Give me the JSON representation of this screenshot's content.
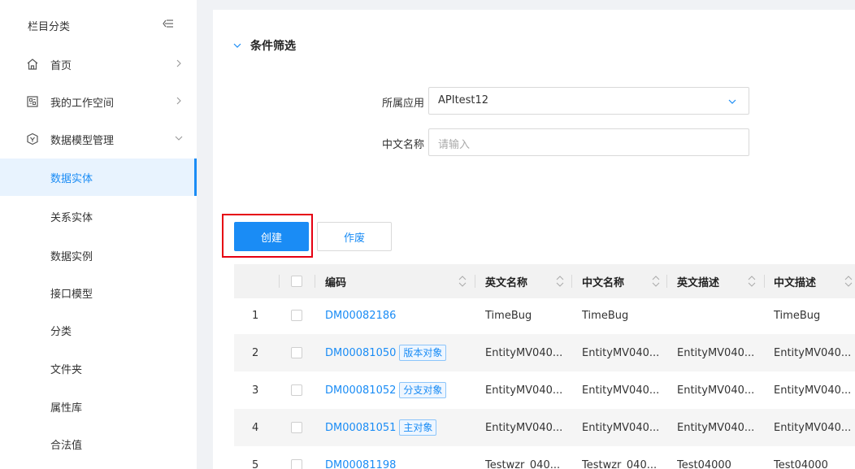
{
  "sidebar": {
    "title": "栏目分类",
    "collapse_icon": "collapse-left-icon",
    "menu": [
      {
        "label": "首页",
        "icon": "home-icon",
        "arrow": "chevron-right-icon"
      },
      {
        "label": "我的工作空间",
        "icon": "workspace-icon",
        "arrow": "chevron-right-icon"
      },
      {
        "label": "数据模型管理",
        "icon": "model-icon",
        "arrow": "chevron-down-icon"
      }
    ],
    "sub_items": [
      {
        "label": "数据实体",
        "active": true
      },
      {
        "label": "关系实体",
        "active": false
      },
      {
        "label": "数据实例",
        "active": false
      },
      {
        "label": "接口模型",
        "active": false
      },
      {
        "label": "分类",
        "active": false
      },
      {
        "label": "文件夹",
        "active": false
      },
      {
        "label": "属性库",
        "active": false
      },
      {
        "label": "合法值",
        "active": false
      }
    ]
  },
  "filter": {
    "title": "条件筛选",
    "app_label": "所属应用",
    "app_value": "APItest12",
    "name_label": "中文名称",
    "name_placeholder": "请输入"
  },
  "actions": {
    "create_label": "创建",
    "void_label": "作废"
  },
  "table": {
    "headers": [
      "编码",
      "英文名称",
      "中文名称",
      "英文描述",
      "中文描述"
    ],
    "rows": [
      {
        "index": "1",
        "code": "DM00082186",
        "tag": "",
        "en_name": "TimeBug",
        "cn_name": "TimeBug",
        "en_desc": "",
        "cn_desc": "TimeBug"
      },
      {
        "index": "2",
        "code": "DM00081050",
        "tag": "版本对象",
        "en_name": "EntityMV040...",
        "cn_name": "EntityMV040...",
        "en_desc": "EntityMV040...",
        "cn_desc": "EntityMV040..."
      },
      {
        "index": "3",
        "code": "DM00081052",
        "tag": "分支对象",
        "en_name": "EntityMV040...",
        "cn_name": "EntityMV040...",
        "en_desc": "EntityMV040...",
        "cn_desc": "EntityMV040..."
      },
      {
        "index": "4",
        "code": "DM00081051",
        "tag": "主对象",
        "en_name": "EntityMV040...",
        "cn_name": "EntityMV040...",
        "en_desc": "EntityMV040...",
        "cn_desc": "EntityMV040..."
      },
      {
        "index": "5",
        "code": "DM00081198",
        "tag": "",
        "en_name": "Testwzr_040...",
        "cn_name": "Testwzr_040...",
        "en_desc": "Test04000",
        "cn_desc": "Test04000"
      }
    ]
  },
  "colors": {
    "accent": "#1a8cf5",
    "highlight_box": "#e60012"
  }
}
